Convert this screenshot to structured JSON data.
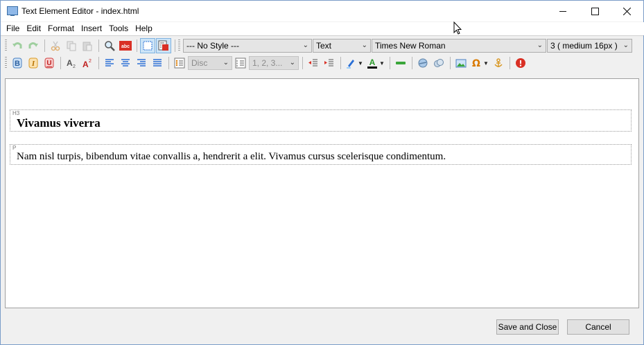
{
  "window": {
    "title": "Text Element Editor - index.html"
  },
  "menu": [
    "File",
    "Edit",
    "Format",
    "Insert",
    "Tools",
    "Help"
  ],
  "toolbar1": {
    "style_combo": "--- No Style ---",
    "element_combo": "Text",
    "font_combo": "Times New Roman",
    "size_combo": "3 ( medium 16px )"
  },
  "toolbar2": {
    "list_style_combo": "Disc",
    "numbering_combo": "1, 2, 3..."
  },
  "document": {
    "blocks": [
      {
        "tag": "H3",
        "text": "Vivamus viverra"
      },
      {
        "tag": "P",
        "text": "Nam nisl turpis, bibendum vitae convallis a, hendrerit a elit. Vivamus cursus scelerisque condimentum."
      }
    ]
  },
  "footer": {
    "save_label": "Save and Close",
    "cancel_label": "Cancel"
  },
  "colors": {
    "accent": "#3a6ea5",
    "active_button": "#cce4f7",
    "highlight_marker": "#2a6fd6",
    "font_color_bar": "#000000",
    "insert_hr": "#3aa63a",
    "help_icon": "#d93025"
  }
}
